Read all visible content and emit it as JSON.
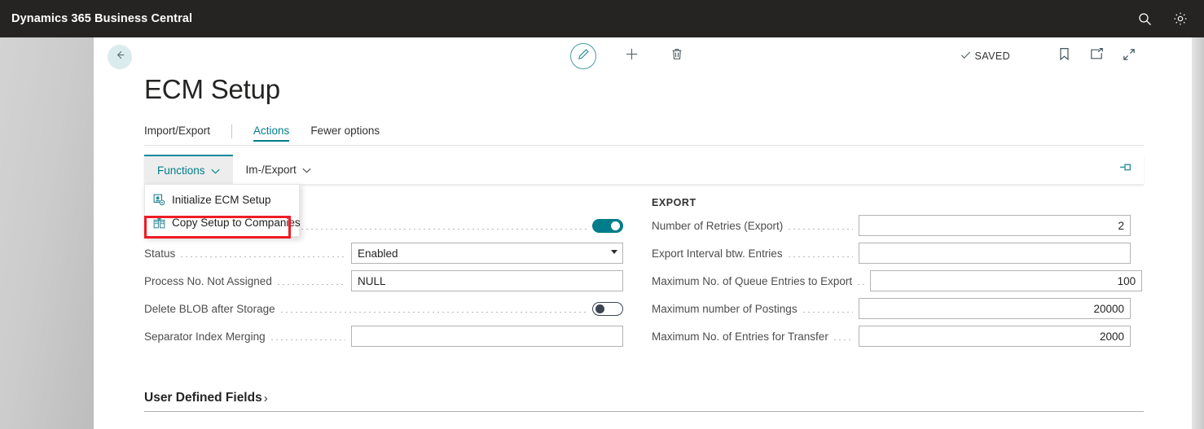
{
  "appbar": {
    "title": "Dynamics 365 Business Central",
    "search_icon": "search-icon",
    "settings_icon": "gear-icon"
  },
  "commandbar": {
    "back_icon": "arrow-left-icon",
    "edit_icon": "pencil-icon",
    "new_icon": "plus-icon",
    "delete_icon": "trash-icon",
    "saved_label": "SAVED",
    "check_icon": "check-icon",
    "bookmark_icon": "bookmark-icon",
    "open_new_window_icon": "open-in-new-window-icon",
    "collapse_icon": "collapse-arrows-icon"
  },
  "page": {
    "title": "ECM Setup"
  },
  "navtabs": [
    {
      "label": "Import/Export",
      "active": false
    },
    {
      "label": "Actions",
      "active": true
    },
    {
      "label": "Fewer options",
      "active": false
    }
  ],
  "ribbon": {
    "buttons": [
      {
        "label": "Functions",
        "active": true,
        "caret": "⌄"
      },
      {
        "label": "Im-/Export",
        "active": false,
        "caret": "⌄"
      }
    ],
    "pin_icon": "pin-icon"
  },
  "dropdown": {
    "items": [
      {
        "label": "Initialize ECM Setup",
        "icon": "initialize-setup-icon",
        "highlighted": false
      },
      {
        "label": "Copy Setup to Companies",
        "icon": "copy-to-companies-icon",
        "highlighted": true
      }
    ]
  },
  "annotation": {
    "color": "#ee1c25",
    "target": "Copy Setup to Companies"
  },
  "form": {
    "left": {
      "rows": [
        {
          "label": "",
          "type": "toggle",
          "value": "on"
        },
        {
          "label": "Status",
          "type": "select",
          "value": "Enabled"
        },
        {
          "label": "Process No. Not Assigned",
          "type": "text",
          "value": "NULL"
        },
        {
          "label": "Delete BLOB after Storage",
          "type": "toggle",
          "value": "off"
        },
        {
          "label": "Separator Index Merging",
          "type": "text",
          "value": ""
        }
      ]
    },
    "right": {
      "section_title": "EXPORT",
      "rows": [
        {
          "label": "Number of Retries (Export)",
          "type": "number",
          "value": "2"
        },
        {
          "label": "Export Interval btw. Entries",
          "type": "number",
          "value": ""
        },
        {
          "label": "Maximum No. of Queue Entries to Export",
          "type": "number",
          "value": "100"
        },
        {
          "label": "Maximum number of Postings",
          "type": "number",
          "value": "20000"
        },
        {
          "label": "Maximum No. of Entries for Transfer",
          "type": "number",
          "value": "2000"
        }
      ]
    }
  },
  "user_defined_fields": {
    "label": "User Defined Fields",
    "chevron": "›"
  },
  "colors": {
    "accent": "#007d8a",
    "appbar_bg": "#252423",
    "annotation_red": "#ee1c25",
    "back_btn_bg": "#daeced"
  }
}
